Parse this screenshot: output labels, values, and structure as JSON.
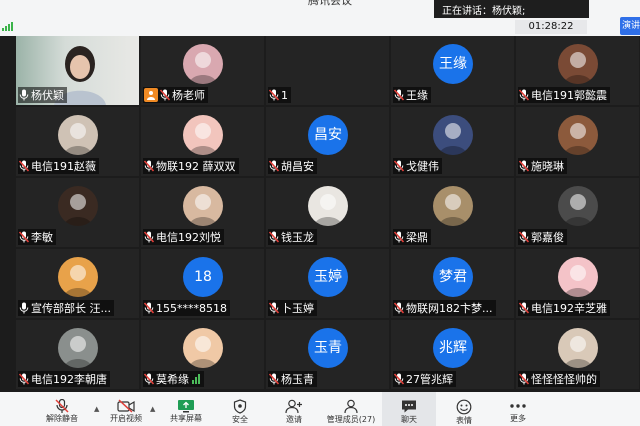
{
  "app": {
    "title": "腾讯会议"
  },
  "status": {
    "speaking_label": "正在讲话：杨伏颖;",
    "timer": "01:28:22",
    "view_button": "演讲"
  },
  "participants": [
    {
      "name": "杨伏颖",
      "avatar": {
        "type": "video"
      },
      "mic": "on",
      "active": true
    },
    {
      "name": "杨老师",
      "avatar": {
        "type": "image",
        "icon": "cartoon-avatar-icon",
        "color": "#d9a8b0"
      },
      "mic": "muted",
      "host": true
    },
    {
      "name": "1",
      "avatar": {
        "type": "none"
      },
      "mic": "muted"
    },
    {
      "name": "王缘",
      "avatar": {
        "type": "text",
        "text": "王缘"
      },
      "mic": "muted"
    },
    {
      "name": "电信191郭懿震",
      "avatar": {
        "type": "image",
        "icon": "person-avatar-icon",
        "color": "#7a4a35"
      },
      "mic": "muted"
    },
    {
      "name": "电信191赵薇",
      "avatar": {
        "type": "image",
        "icon": "person-avatar-icon",
        "color": "#cfc2b5"
      },
      "mic": "muted"
    },
    {
      "name": "物联192 薛双双",
      "avatar": {
        "type": "image",
        "icon": "pig-avatar-icon",
        "color": "#f2c5bd"
      },
      "mic": "muted"
    },
    {
      "name": "胡昌安",
      "avatar": {
        "type": "text",
        "text": "昌安"
      },
      "mic": "muted"
    },
    {
      "name": "戈健伟",
      "avatar": {
        "type": "image",
        "icon": "anime-avatar-icon",
        "color": "#3c4d7d"
      },
      "mic": "muted"
    },
    {
      "name": "施晓琳",
      "avatar": {
        "type": "image",
        "icon": "person-avatar-icon",
        "color": "#8c5a3c"
      },
      "mic": "muted"
    },
    {
      "name": "李敏",
      "avatar": {
        "type": "image",
        "icon": "person-avatar-icon",
        "color": "#3a2a22"
      },
      "mic": "muted"
    },
    {
      "name": "电信192刘悦",
      "avatar": {
        "type": "image",
        "icon": "person-avatar-icon",
        "color": "#d8b9a0"
      },
      "mic": "muted"
    },
    {
      "name": "钱玉龙",
      "avatar": {
        "type": "image",
        "icon": "person-avatar-icon",
        "color": "#e9e6e1"
      },
      "mic": "muted"
    },
    {
      "name": "梁鼎",
      "avatar": {
        "type": "image",
        "icon": "anime-avatar-icon",
        "color": "#a88f6a"
      },
      "mic": "muted"
    },
    {
      "name": "郭嘉俊",
      "avatar": {
        "type": "image",
        "icon": "person-avatar-icon",
        "color": "#4b4b4b"
      },
      "mic": "muted"
    },
    {
      "name": "宣传部部长 汪...",
      "avatar": {
        "type": "image",
        "icon": "tiger-avatar-icon",
        "color": "#e8a24a"
      },
      "mic": "on"
    },
    {
      "name": "155****8518",
      "avatar": {
        "type": "text",
        "text": "18"
      },
      "mic": "muted"
    },
    {
      "name": "卜玉婷",
      "avatar": {
        "type": "text",
        "text": "玉婷"
      },
      "mic": "muted"
    },
    {
      "name": "物联网182卞梦...",
      "avatar": {
        "type": "text",
        "text": "梦君"
      },
      "mic": "muted"
    },
    {
      "name": "电信192辛芝雅",
      "avatar": {
        "type": "image",
        "icon": "dino-avatar-icon",
        "color": "#f4c3c8"
      },
      "mic": "muted"
    },
    {
      "name": "电信192李朝唐",
      "avatar": {
        "type": "image",
        "icon": "ink-avatar-icon",
        "color": "#8a8f8d"
      },
      "mic": "muted"
    },
    {
      "name": "莫希缘",
      "avatar": {
        "type": "image",
        "icon": "cat-avatar-icon",
        "color": "#f0c9a6"
      },
      "mic": "muted",
      "volume": true
    },
    {
      "name": "杨玉青",
      "avatar": {
        "type": "text",
        "text": "玉青"
      },
      "mic": "muted"
    },
    {
      "name": "27管兆辉",
      "avatar": {
        "type": "text",
        "text": "兆辉"
      },
      "mic": "muted"
    },
    {
      "name": "怪怪怪怪帅的",
      "avatar": {
        "type": "image",
        "icon": "person-avatar-icon",
        "color": "#d9c9b8"
      },
      "mic": "muted"
    }
  ],
  "toolbar": {
    "mute": "解除静音",
    "video": "开启视频",
    "share": "共享屏幕",
    "security": "安全",
    "invite": "邀请",
    "manage": "管理成员(27)",
    "chat": "聊天",
    "emoji": "表情",
    "more": "更多"
  },
  "colors": {
    "accent": "#1a73ea",
    "active_border": "#3fc0a0",
    "muted_icon": "#e0403a",
    "host_badge": "#f08a24"
  }
}
